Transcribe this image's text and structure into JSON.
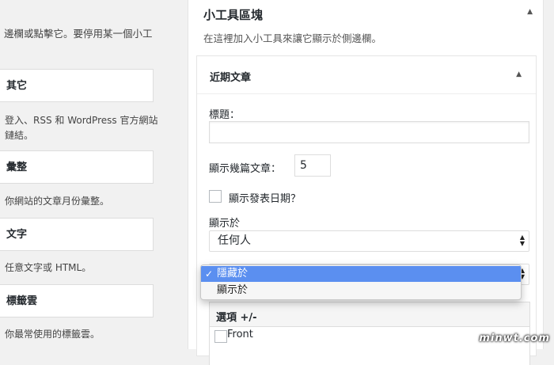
{
  "left": {
    "intro": "邊欄或點擊它。要停用某一個小工",
    "widgets": [
      {
        "name": "其它",
        "desc": "登入、RSS 和 WordPress 官方網站鏈結。"
      },
      {
        "name": "彙整",
        "desc": "你網站的文章月份彙整。"
      },
      {
        "name": "文字",
        "desc": "任意文字或 HTML。"
      },
      {
        "name": "標籤雲",
        "desc": "你最常使用的標籤雲。"
      }
    ]
  },
  "sidebar": {
    "title": "小工具區塊",
    "description": "在這裡加入小工具來讓它顯示於側邊欄。"
  },
  "widget": {
    "title": "近期文章",
    "title_label": "標題：",
    "title_value": "",
    "count_label": "顯示幾篇文章：",
    "count_value": "5",
    "show_date_label": "顯示發表日期？",
    "visibility_label": "顯示於",
    "visibility_value": "任何人",
    "options_title": "選項 +/-",
    "front_label": "Front"
  },
  "dropdown": {
    "options": [
      "隱藏於",
      "顯示於"
    ],
    "selected": "隱藏於",
    "check": "✓"
  },
  "watermark": "minwt.com"
}
